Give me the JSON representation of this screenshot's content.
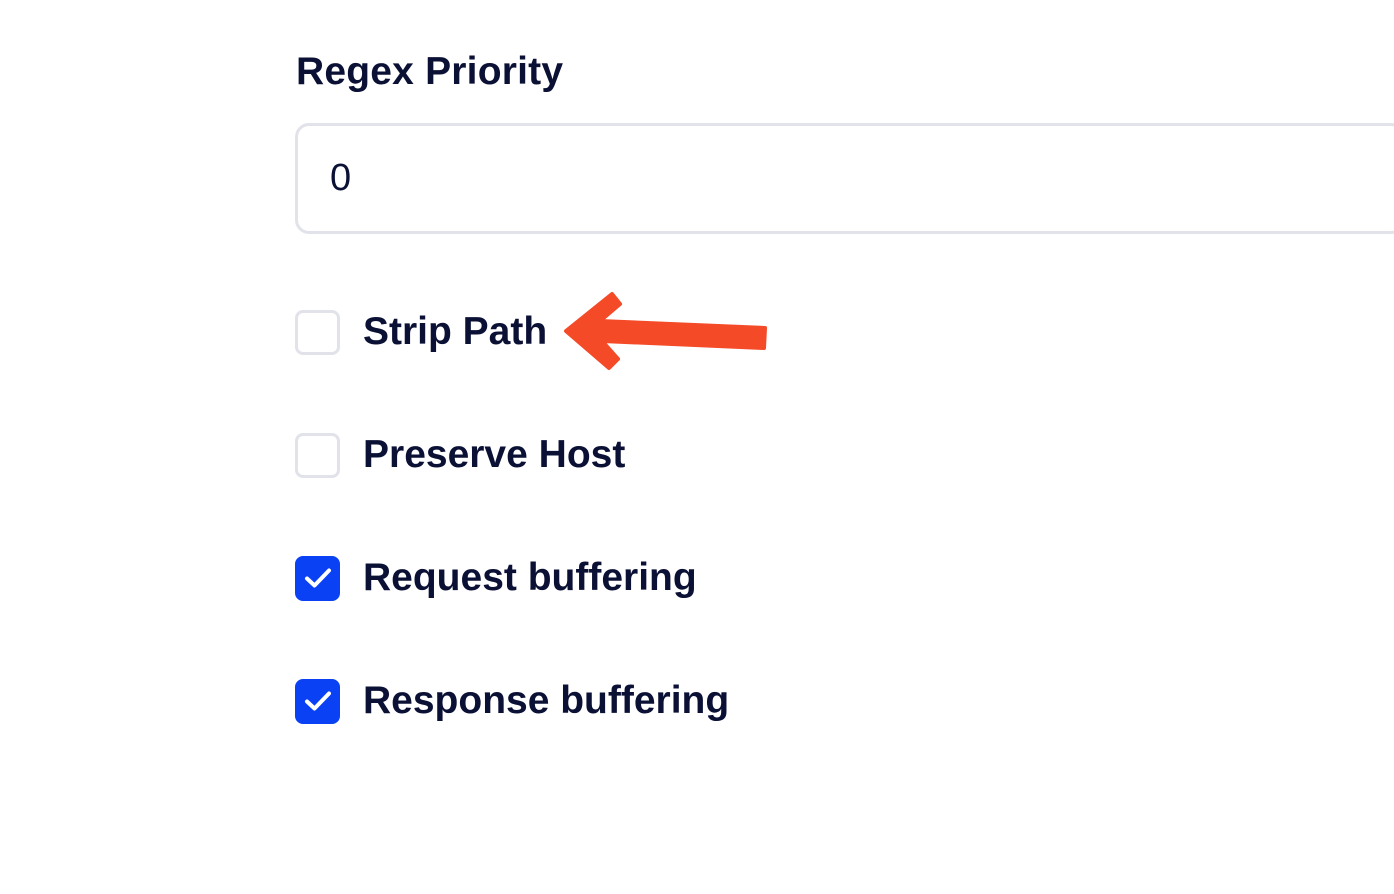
{
  "form": {
    "regex_priority": {
      "label": "Regex Priority",
      "value": "0"
    },
    "options": [
      {
        "label": "Strip Path",
        "checked": false
      },
      {
        "label": "Preserve Host",
        "checked": false
      },
      {
        "label": "Request buffering",
        "checked": true
      },
      {
        "label": "Response buffering",
        "checked": true
      }
    ]
  },
  "annotation": {
    "icon": "arrow-left-icon",
    "color": "#f44a27",
    "points_to": "Strip Path"
  },
  "colors": {
    "accent": "#0a41f5",
    "text": "#0b1035",
    "border": "#e2e3ea"
  }
}
